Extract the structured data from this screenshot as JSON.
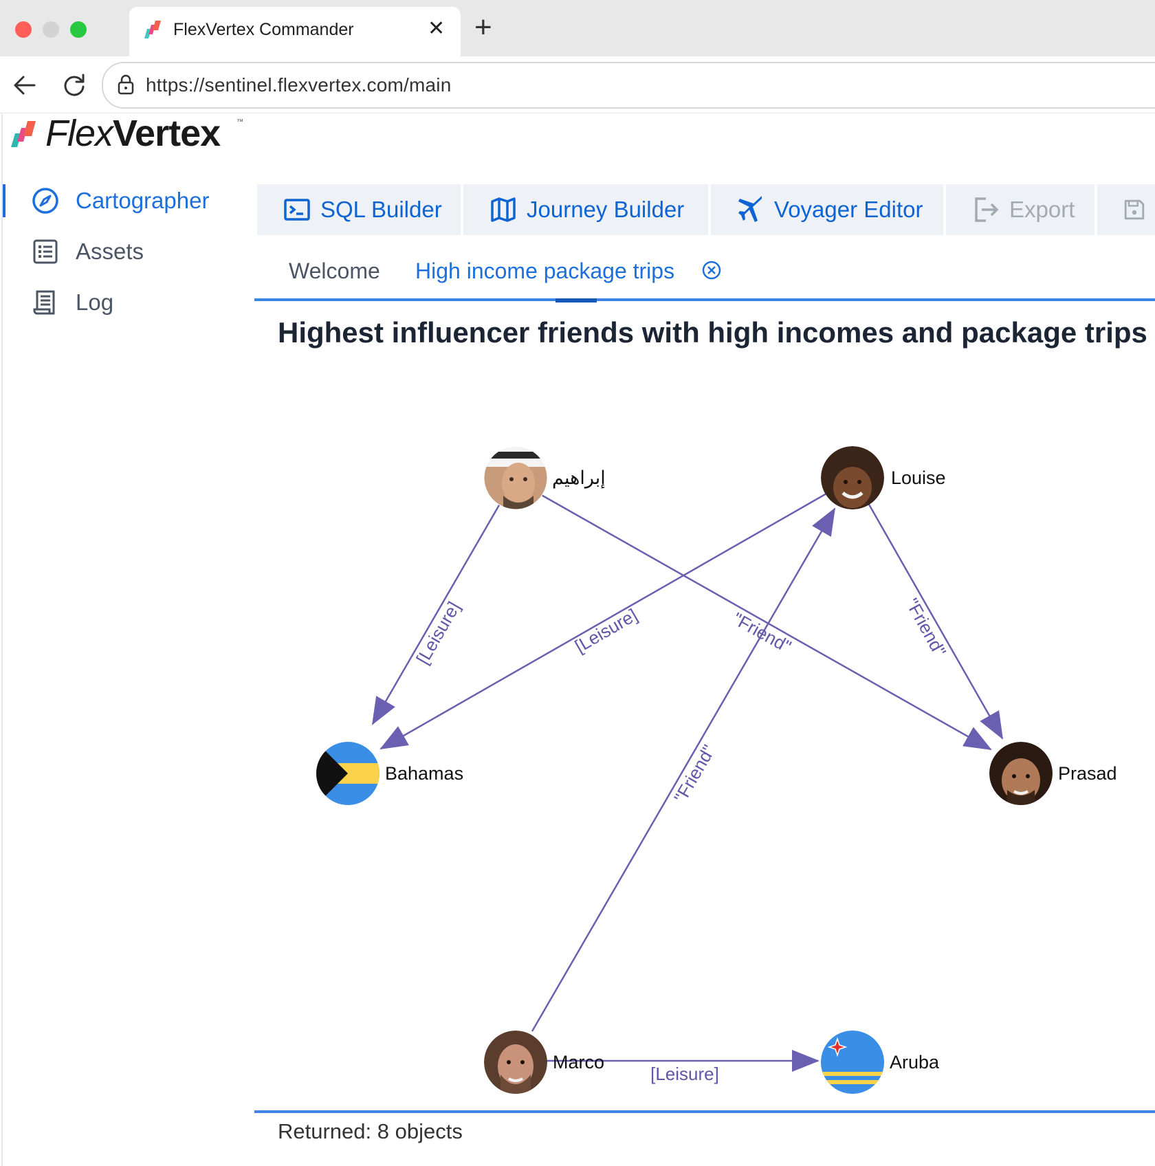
{
  "browser": {
    "tab_title": "FlexVertex Commander",
    "close_glyph": "✕",
    "new_tab_glyph": "+",
    "url": "https://sentinel.flexvertex.com/main"
  },
  "app": {
    "brand_light": "Flex",
    "brand_bold": "Vertex",
    "brand_tm": "™"
  },
  "sidebar": {
    "items": [
      {
        "label": "Cartographer",
        "icon": "compass-icon",
        "active": true
      },
      {
        "label": "Assets",
        "icon": "list-icon",
        "active": false
      },
      {
        "label": "Log",
        "icon": "receipt-icon",
        "active": false
      }
    ]
  },
  "toolbar": {
    "buttons": [
      {
        "label": "SQL Builder",
        "icon": "terminal-icon",
        "enabled": true
      },
      {
        "label": "Journey Builder",
        "icon": "map-icon",
        "enabled": true
      },
      {
        "label": "Voyager Editor",
        "icon": "airplane-icon",
        "enabled": true
      },
      {
        "label": "Export",
        "icon": "export-icon",
        "enabled": false
      },
      {
        "label": "",
        "icon": "save-icon",
        "enabled": false
      }
    ]
  },
  "tabs": {
    "items": [
      {
        "label": "Welcome",
        "active": false
      },
      {
        "label": "High income package trips",
        "active": true,
        "closable": true
      }
    ]
  },
  "query": {
    "title": "Highest influencer friends with high incomes and package trips"
  },
  "graph": {
    "nodes": {
      "ibrahim": {
        "label": "إبراهيم",
        "kind": "person"
      },
      "louise": {
        "label": "Louise",
        "kind": "person"
      },
      "bahamas": {
        "label": "Bahamas",
        "kind": "country-flag"
      },
      "prasad": {
        "label": "Prasad",
        "kind": "person"
      },
      "marco": {
        "label": "Marco",
        "kind": "person"
      },
      "aruba": {
        "label": "Aruba",
        "kind": "country-flag"
      }
    },
    "edges": {
      "ibrahim_bahamas": "[Leisure]",
      "louise_bahamas": "[Leisure]",
      "ibrahim_prasad": "\"Friend\"",
      "louise_prasad": "\"Friend\"",
      "marco_louise": "\"Friend\"",
      "marco_aruba": "[Leisure]"
    },
    "edge_color": "#6a5fb0"
  },
  "status": {
    "text": "Returned: 8 objects"
  }
}
